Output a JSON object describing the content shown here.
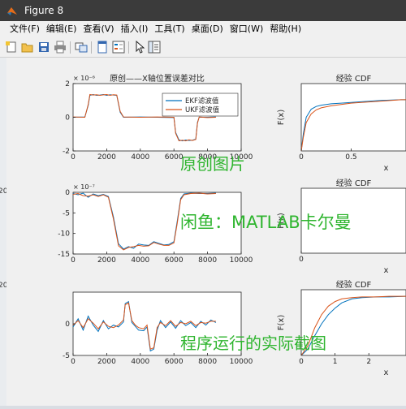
{
  "window": {
    "title": "Figure 8"
  },
  "menu": [
    "文件(F)",
    "编辑(E)",
    "查看(V)",
    "插入(I)",
    "工具(T)",
    "桌面(D)",
    "窗口(W)",
    "帮助(H)"
  ],
  "toolbar": [
    "new-figure-icon",
    "open-folder-icon",
    "save-icon",
    "print-icon",
    "link-plot-icon",
    "dock-icon",
    "legend-icon",
    "pointer-icon",
    "property-editor-icon"
  ],
  "side_labels": [
    "20",
    "20"
  ],
  "watermarks": {
    "line1": "原创图片",
    "line2": "闲鱼：MATLAB卡尔曼",
    "line3": "程序运行的实际截图"
  },
  "colors": {
    "ekf": "#0072bd",
    "ukf": "#d95319",
    "watermark": "#2fb52f"
  },
  "chart_data": [
    {
      "type": "line",
      "title": "原创——X轴位置误差对比",
      "exponent_label": "× 10⁻⁶",
      "xlim": [
        0,
        10000
      ],
      "ylim": [
        -2,
        2
      ],
      "xticks": [
        "0",
        "2000",
        "4000",
        "6000",
        "8000",
        "10000"
      ],
      "yticks": [
        "-2",
        "0",
        "2"
      ],
      "legend": {
        "position": "top-right",
        "entries": [
          "EKF滤波值",
          "UKF滤波值"
        ]
      },
      "x": [
        0,
        700,
        900,
        1000,
        1200,
        1400,
        1600,
        1800,
        2000,
        2200,
        2400,
        2600,
        2800,
        3000,
        4000,
        5000,
        6000,
        6100,
        6300,
        6500,
        6700,
        6900,
        7100,
        7300,
        7400,
        7500,
        8000,
        8500
      ],
      "series": [
        {
          "name": "EKF滤波值",
          "values": [
            0.0,
            0.02,
            0.7,
            1.3,
            1.35,
            1.3,
            1.32,
            1.35,
            1.3,
            1.34,
            1.32,
            1.3,
            0.3,
            0.0,
            0.02,
            0.0,
            -0.02,
            -0.9,
            -1.35,
            -1.4,
            -1.35,
            -1.38,
            -1.36,
            -1.3,
            -0.3,
            0.0,
            0.0,
            0.02
          ]
        },
        {
          "name": "UKF滤波值",
          "values": [
            0.02,
            0.0,
            0.75,
            1.35,
            1.32,
            1.34,
            1.3,
            1.33,
            1.35,
            1.3,
            1.34,
            1.32,
            0.35,
            0.02,
            0.0,
            0.02,
            0.0,
            -0.95,
            -1.4,
            -1.36,
            -1.4,
            -1.34,
            -1.38,
            -1.32,
            -0.35,
            0.02,
            -0.02,
            0.0
          ]
        }
      ]
    },
    {
      "type": "line",
      "exponent_label": "× 10⁻⁷",
      "xlim": [
        0,
        10000
      ],
      "ylim": [
        -15,
        0
      ],
      "xticks": [
        "0",
        "2000",
        "4000",
        "6000",
        "8000",
        "10000"
      ],
      "yticks": [
        "-15",
        "-10",
        "-5",
        "0"
      ],
      "x": [
        0,
        300,
        600,
        900,
        1200,
        1500,
        1800,
        2100,
        2400,
        2700,
        3000,
        3300,
        3600,
        3900,
        4200,
        4500,
        4800,
        5100,
        5400,
        5700,
        6000,
        6200,
        6400,
        6600,
        7000,
        7500,
        8000,
        8500
      ],
      "series": [
        {
          "name": "EKF滤波值",
          "values": [
            -0.3,
            -0.6,
            -0.2,
            -1.2,
            -0.4,
            -0.8,
            -0.5,
            -1.0,
            -6.0,
            -12.5,
            -13.8,
            -13.2,
            -13.6,
            -12.6,
            -12.8,
            -12.9,
            -12.0,
            -12.4,
            -12.8,
            -12.7,
            -12.0,
            -7.0,
            -1.5,
            -0.4,
            -0.2,
            -0.3,
            -0.3,
            -0.2
          ]
        },
        {
          "name": "UKF滤波值",
          "values": [
            -0.5,
            -0.3,
            -0.8,
            -0.9,
            -0.6,
            -1.0,
            -0.6,
            -1.2,
            -6.5,
            -13.0,
            -14.0,
            -13.4,
            -13.2,
            -12.9,
            -13.1,
            -13.0,
            -12.2,
            -12.6,
            -12.9,
            -12.9,
            -12.3,
            -7.5,
            -1.8,
            -0.6,
            -0.3,
            -0.2,
            -0.4,
            -0.3
          ]
        }
      ]
    },
    {
      "type": "line",
      "xlim": [
        0,
        10000
      ],
      "ylim": [
        -5,
        5
      ],
      "xticks": [
        "0",
        "2000",
        "4000",
        "6000",
        "8000",
        "10000"
      ],
      "yticks": [
        "-5",
        "0"
      ],
      "x": [
        0,
        300,
        600,
        900,
        1200,
        1500,
        1800,
        2100,
        2400,
        2700,
        3000,
        3100,
        3300,
        3500,
        3700,
        3900,
        4200,
        4400,
        4600,
        4800,
        5000,
        5200,
        5500,
        5800,
        6100,
        6400,
        6700,
        7000,
        7300,
        7600,
        7900,
        8200,
        8500
      ],
      "series": [
        {
          "name": "EKF滤波值",
          "values": [
            -0.5,
            0.8,
            -1.0,
            1.2,
            -0.2,
            -1.2,
            0.5,
            -0.8,
            -0.2,
            -0.5,
            0.3,
            3.2,
            3.5,
            0.2,
            -0.4,
            -1.0,
            -1.1,
            -0.5,
            -4.3,
            -4.0,
            -1.0,
            0.5,
            -0.6,
            0.3,
            -0.7,
            0.5,
            -0.3,
            0.2,
            -0.6,
            0.4,
            -0.2,
            0.6,
            0.2
          ]
        },
        {
          "name": "UKF滤波值",
          "values": [
            -0.2,
            0.5,
            -0.6,
            0.8,
            0.1,
            -0.8,
            0.3,
            -0.4,
            -0.6,
            -0.2,
            0.6,
            3.0,
            3.3,
            0.5,
            -0.2,
            -0.6,
            -0.8,
            -0.2,
            -4.0,
            -3.8,
            -0.6,
            0.2,
            -0.3,
            0.5,
            -0.4,
            0.2,
            0.0,
            0.4,
            -0.3,
            0.2,
            0.1,
            0.4,
            0.4
          ]
        }
      ]
    },
    {
      "type": "line",
      "title": "经验 CDF",
      "xlabel": "x",
      "ylabel": "F(x)",
      "xlim": [
        0,
        1.05
      ],
      "ylim": [
        0,
        1
      ],
      "xticks": [
        "0",
        "0.5"
      ],
      "x": [
        0,
        0.02,
        0.05,
        0.1,
        0.15,
        0.2,
        0.3,
        0.4,
        0.5,
        0.6,
        0.8,
        1.0,
        1.05
      ],
      "series": [
        {
          "name": "EKF滤波值",
          "values": [
            0.0,
            0.25,
            0.5,
            0.62,
            0.66,
            0.68,
            0.7,
            0.71,
            0.72,
            0.73,
            0.75,
            0.76,
            0.76
          ]
        },
        {
          "name": "UKF滤波值",
          "values": [
            0.0,
            0.2,
            0.42,
            0.55,
            0.61,
            0.64,
            0.67,
            0.69,
            0.71,
            0.72,
            0.74,
            0.76,
            0.76
          ]
        }
      ]
    },
    {
      "type": "line",
      "title": "经验 CDF",
      "xlabel": "x",
      "ylabel": "F(x)",
      "xlim": [
        0,
        1.05
      ],
      "ylim": [
        0,
        1
      ],
      "xticks": [
        "0"
      ],
      "x": [
        0,
        1.05
      ],
      "series": []
    },
    {
      "type": "line",
      "title": "经验 CDF",
      "xlabel": "x",
      "ylabel": "F(x)",
      "xlim": [
        0,
        3.1
      ],
      "ylim": [
        0,
        1
      ],
      "xticks": [
        "0",
        "1",
        "2"
      ],
      "x": [
        0,
        0.2,
        0.4,
        0.6,
        0.8,
        1.0,
        1.2,
        1.5,
        1.8,
        2.2,
        2.6,
        3.1
      ],
      "series": [
        {
          "name": "EKF滤波值",
          "values": [
            0.0,
            0.1,
            0.3,
            0.48,
            0.62,
            0.72,
            0.8,
            0.86,
            0.88,
            0.89,
            0.89,
            0.9
          ]
        },
        {
          "name": "UKF滤波值",
          "values": [
            0.0,
            0.15,
            0.42,
            0.62,
            0.75,
            0.82,
            0.86,
            0.88,
            0.89,
            0.89,
            0.9,
            0.9
          ]
        }
      ]
    }
  ]
}
